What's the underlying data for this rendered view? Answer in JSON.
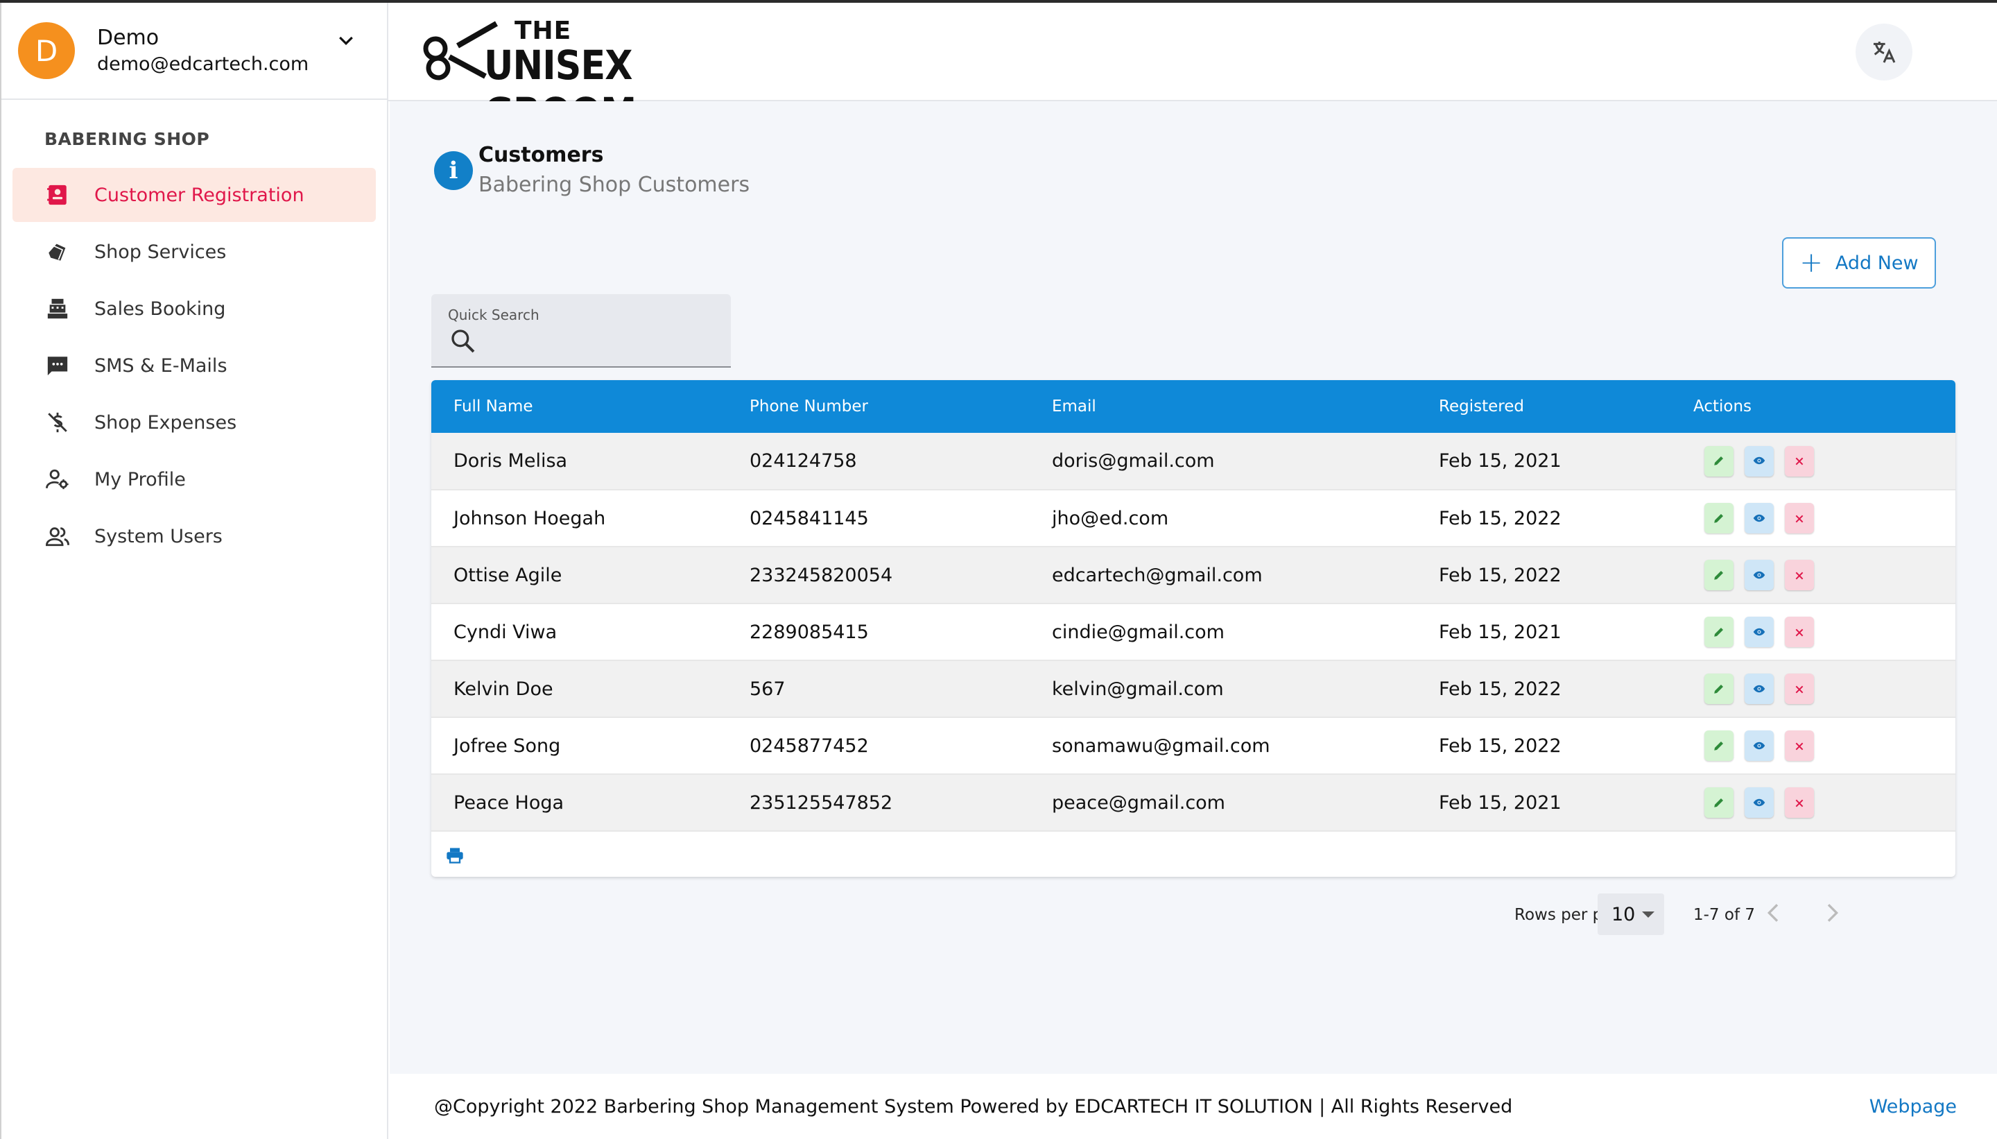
{
  "user": {
    "initial": "D",
    "name": "Demo",
    "email": "demo@edcartech.com"
  },
  "sidebar": {
    "section_title": "BABERING SHOP",
    "items": [
      {
        "label": "Customer Registration",
        "icon": "contact-card-icon",
        "active": true
      },
      {
        "label": "Shop Services",
        "icon": "tag-icon",
        "active": false
      },
      {
        "label": "Sales Booking",
        "icon": "cash-register-icon",
        "active": false
      },
      {
        "label": "SMS & E-Mails",
        "icon": "message-icon",
        "active": false
      },
      {
        "label": "Shop Expenses",
        "icon": "money-off-icon",
        "active": false
      },
      {
        "label": "My Profile",
        "icon": "user-settings-icon",
        "active": false
      },
      {
        "label": "System Users",
        "icon": "users-icon",
        "active": false
      }
    ]
  },
  "header": {
    "logo_top": "THE",
    "logo_main": "UNISEX GROOM"
  },
  "page": {
    "title": "Customers",
    "subtitle": "Babering Shop Customers"
  },
  "toolbar": {
    "add_label": "Add New"
  },
  "search": {
    "label": "Quick Search",
    "value": ""
  },
  "table": {
    "columns": [
      "Full Name",
      "Phone Number",
      "Email",
      "Registered",
      "Actions"
    ],
    "rows": [
      {
        "name": "Doris Melisa",
        "phone": "024124758",
        "email": "doris@gmail.com",
        "registered": "Feb 15, 2021"
      },
      {
        "name": "Johnson Hoegah",
        "phone": "0245841145",
        "email": "jho@ed.com",
        "registered": "Feb 15, 2022"
      },
      {
        "name": "Ottise Agile",
        "phone": "233245820054",
        "email": "edcartech@gmail.com",
        "registered": "Feb 15, 2022"
      },
      {
        "name": "Cyndi Viwa",
        "phone": "2289085415",
        "email": "cindie@gmail.com",
        "registered": "Feb 15, 2021"
      },
      {
        "name": "Kelvin Doe",
        "phone": "567",
        "email": "kelvin@gmail.com",
        "registered": "Feb 15, 2022"
      },
      {
        "name": "Jofree Song",
        "phone": "0245877452",
        "email": "sonamawu@gmail.com",
        "registered": "Feb 15, 2022"
      },
      {
        "name": "Peace Hoga",
        "phone": "235125547852",
        "email": "peace@gmail.com",
        "registered": "Feb 15, 2021"
      }
    ]
  },
  "pagination": {
    "rows_label": "Rows per page:",
    "rows_value": "10",
    "range": "1-7 of 7"
  },
  "footer": {
    "text": "@Copyright 2022 Barbering Shop Management System Powered by EDCARTECH IT SOLUTION | All Rights Reserved",
    "link": "Webpage"
  },
  "colors": {
    "accent": "#0f89d8",
    "active_nav_bg": "#fde8e1",
    "active_nav_text": "#e0174a",
    "avatar": "#f5901e"
  }
}
